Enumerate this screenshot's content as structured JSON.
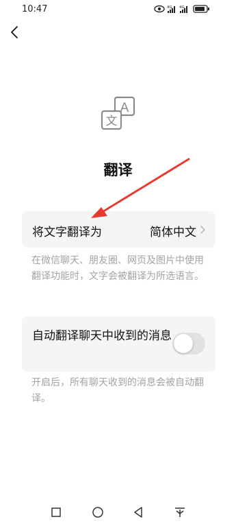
{
  "status_bar": {
    "time": "10:47",
    "network_1": "4G",
    "network_2": "4G"
  },
  "header": {
    "back_icon": "chevron-left-icon"
  },
  "hero": {
    "icon": "translate-icon",
    "icon_glyph_front": "文",
    "icon_glyph_back": "A",
    "title": "翻译"
  },
  "language_setting": {
    "label": "将文字翻译为",
    "value": "简体中文",
    "description": "在微信聊天、朋友圈、网页及图片中使用翻译功能时，文字会被翻译为所选语言。"
  },
  "auto_translate": {
    "label": "自动翻译聊天中收到的消息",
    "enabled": false,
    "description": "开启后，所有聊天收到的消息会被自动翻译。"
  },
  "annotation": {
    "type": "red-arrow",
    "color": "#e8392f"
  },
  "nav_bar": {
    "icons": [
      "square-icon",
      "circle-icon",
      "triangle-back-icon",
      "download-arrow-icon"
    ]
  },
  "colors": {
    "background": "#ffffff",
    "card": "#f5f5f5",
    "muted_text": "#a3a3a3",
    "toggle_off": "#e2e2e2"
  }
}
